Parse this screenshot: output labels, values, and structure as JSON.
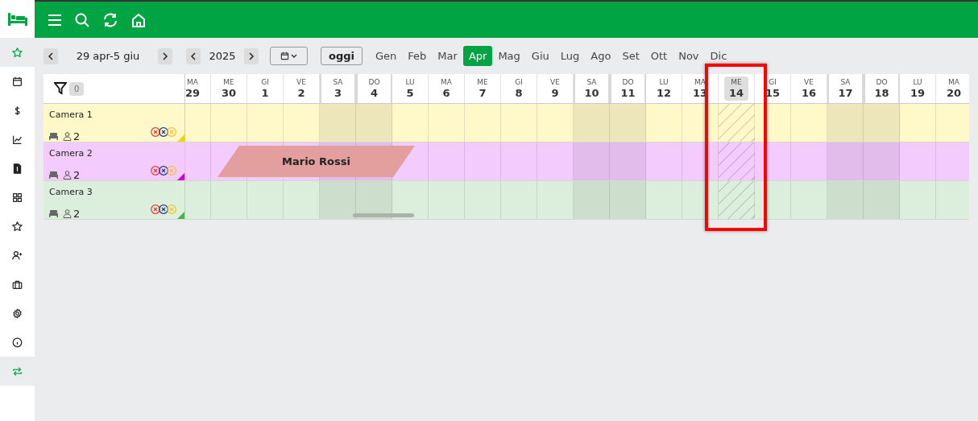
{
  "sidebar": {
    "items": [
      {
        "selected": true
      },
      {
        "selected": false
      },
      {
        "selected": false
      },
      {
        "selected": false
      },
      {
        "selected": false
      },
      {
        "selected": false
      },
      {
        "selected": false
      },
      {
        "selected": false
      },
      {
        "selected": false
      },
      {
        "selected": false
      },
      {
        "selected": false
      },
      {
        "selected": true
      }
    ]
  },
  "toolbar": {
    "range_label": "29 apr-5 giu",
    "year": "2025",
    "today_button": "oggi",
    "months": [
      {
        "label": "Gen",
        "selected": false
      },
      {
        "label": "Feb",
        "selected": false
      },
      {
        "label": "Mar",
        "selected": false
      },
      {
        "label": "Apr",
        "selected": true
      },
      {
        "label": "Mag",
        "selected": false
      },
      {
        "label": "Giu",
        "selected": false
      },
      {
        "label": "Lug",
        "selected": false
      },
      {
        "label": "Ago",
        "selected": false
      },
      {
        "label": "Set",
        "selected": false
      },
      {
        "label": "Ott",
        "selected": false
      },
      {
        "label": "Nov",
        "selected": false
      },
      {
        "label": "Dic",
        "selected": false
      }
    ]
  },
  "filter": {
    "count": "0"
  },
  "days": [
    {
      "dow": "MA",
      "day": "29",
      "weekend": false,
      "selected": false
    },
    {
      "dow": "ME",
      "day": "30",
      "weekend": false,
      "selected": false
    },
    {
      "dow": "GI",
      "day": "1",
      "weekend": false,
      "selected": false
    },
    {
      "dow": "VE",
      "day": "2",
      "weekend": false,
      "selected": false
    },
    {
      "dow": "SA",
      "day": "3",
      "weekend": true,
      "selected": false
    },
    {
      "dow": "DO",
      "day": "4",
      "weekend": true,
      "selected": false
    },
    {
      "dow": "LU",
      "day": "5",
      "weekend": false,
      "selected": false
    },
    {
      "dow": "MA",
      "day": "6",
      "weekend": false,
      "selected": false
    },
    {
      "dow": "ME",
      "day": "7",
      "weekend": false,
      "selected": false
    },
    {
      "dow": "GI",
      "day": "8",
      "weekend": false,
      "selected": false
    },
    {
      "dow": "VE",
      "day": "9",
      "weekend": false,
      "selected": false
    },
    {
      "dow": "SA",
      "day": "10",
      "weekend": true,
      "selected": false
    },
    {
      "dow": "DO",
      "day": "11",
      "weekend": true,
      "selected": false
    },
    {
      "dow": "LU",
      "day": "12",
      "weekend": false,
      "selected": false
    },
    {
      "dow": "MA",
      "day": "13",
      "weekend": false,
      "selected": false
    },
    {
      "dow": "ME",
      "day": "14",
      "weekend": false,
      "selected": true
    },
    {
      "dow": "GI",
      "day": "15",
      "weekend": false,
      "selected": false
    },
    {
      "dow": "VE",
      "day": "16",
      "weekend": false,
      "selected": false
    },
    {
      "dow": "SA",
      "day": "17",
      "weekend": true,
      "selected": false
    },
    {
      "dow": "DO",
      "day": "18",
      "weekend": true,
      "selected": false
    },
    {
      "dow": "LU",
      "day": "19",
      "weekend": false,
      "selected": false
    },
    {
      "dow": "MA",
      "day": "20",
      "weekend": false,
      "selected": false
    }
  ],
  "rooms": [
    {
      "name": "Camera 1",
      "guests": "2",
      "color": "#f5d400"
    },
    {
      "name": "Camera 2",
      "guests": "2",
      "color": "#c800e0",
      "bookings": [
        {
          "guest": "Mario Rossi"
        }
      ]
    },
    {
      "name": "Camera 3",
      "guests": "2",
      "color": "#4caf50"
    }
  ],
  "highlight_frame": true
}
